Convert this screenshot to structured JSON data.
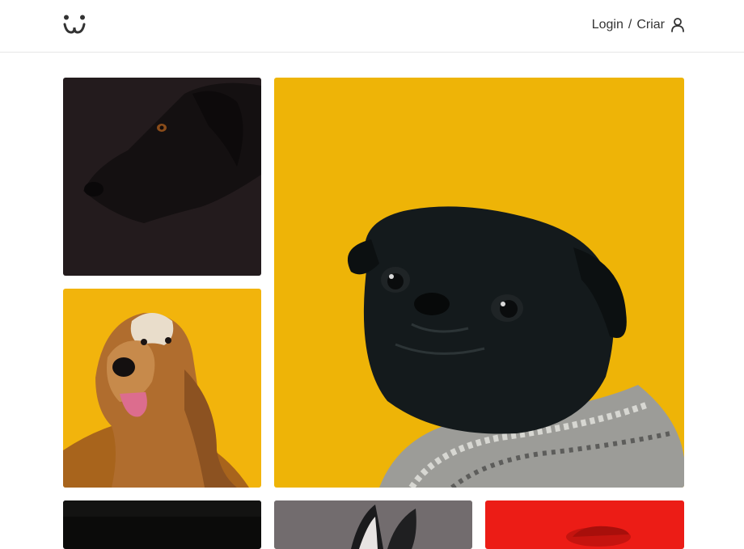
{
  "header": {
    "logo_icon": "dog-face-logo-icon",
    "login_label": "Login",
    "separator": "/",
    "create_label": "Criar",
    "user_icon": "user-icon"
  },
  "feed": {
    "photos": [
      {
        "subject": "black-dog-dark-background",
        "bg": "#231b1d"
      },
      {
        "subject": "black-pug-yellow-background",
        "bg": "#eeb407"
      },
      {
        "subject": "afghan-hound-yellow-background",
        "bg": "#f2b40c"
      },
      {
        "subject": "dark-photo",
        "bg": "#0b0b0a"
      },
      {
        "subject": "dog-ears-photo",
        "bg": "#6b6567"
      },
      {
        "subject": "red-photo",
        "bg": "#ec1c16"
      }
    ]
  },
  "colors": {
    "border": "#e6e6e6",
    "text": "#333333"
  }
}
